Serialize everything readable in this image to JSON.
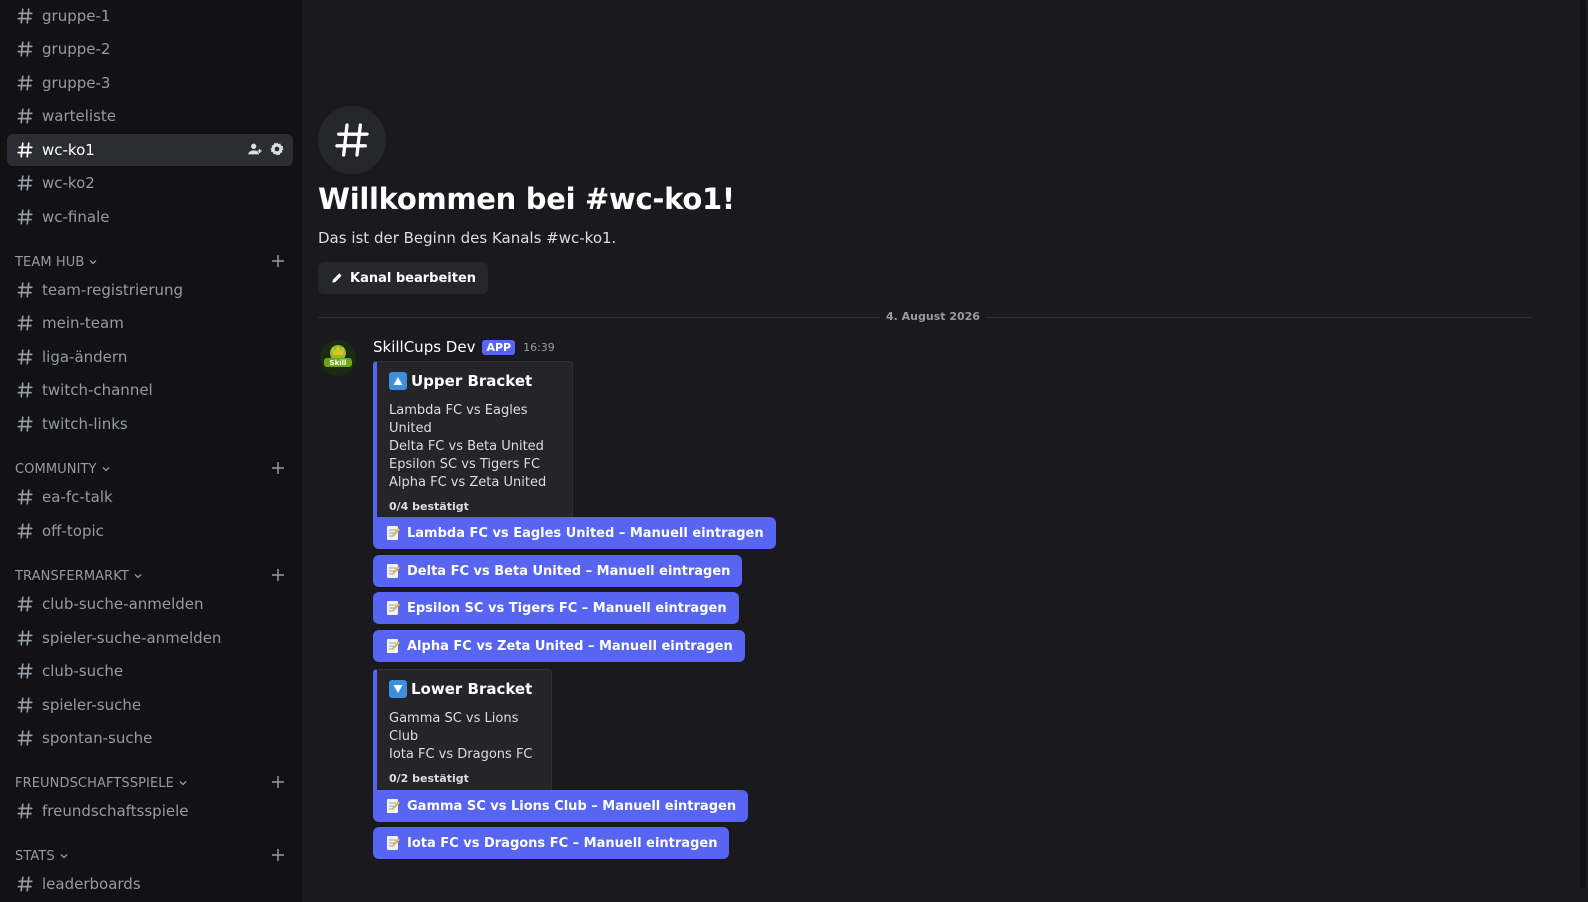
{
  "sidebar": {
    "channels_top": [
      {
        "label": "gruppe-1"
      },
      {
        "label": "gruppe-2"
      },
      {
        "label": "gruppe-3"
      },
      {
        "label": "warteliste"
      },
      {
        "label": "wc-ko1",
        "active": true
      },
      {
        "label": "wc-ko2"
      },
      {
        "label": "wc-finale"
      }
    ],
    "categories": [
      {
        "label": "TEAM HUB",
        "channels": [
          "team-registrierung",
          "mein-team",
          "liga-ändern",
          "twitch-channel",
          "twitch-links"
        ]
      },
      {
        "label": "COMMUNITY",
        "channels": [
          "ea-fc-talk",
          "off-topic"
        ]
      },
      {
        "label": "TRANSFERMARKT",
        "channels": [
          "club-suche-anmelden",
          "spieler-suche-anmelden",
          "club-suche",
          "spieler-suche",
          "spontan-suche"
        ]
      },
      {
        "label": "FREUNDSCHAFTSSPIELE",
        "channels": [
          "freundschaftsspiele"
        ]
      },
      {
        "label": "STATS",
        "channels": [
          "leaderboards"
        ]
      }
    ],
    "icons": {
      "channel": "hash-icon",
      "invite": "add-member-icon",
      "settings": "gear-icon",
      "category_toggle": "chevron-down-icon",
      "create_channel": "plus-icon"
    }
  },
  "main": {
    "welcome_title": "Willkommen bei #wc-ko1!",
    "welcome_subtitle": "Das ist der Beginn des Kanals #wc-ko1.",
    "edit_channel_label": "Kanal bearbeiten",
    "date_divider": "4. August 2026",
    "message": {
      "author": "SkillCups Dev",
      "badge": "APP",
      "time": "16:39",
      "upper_embed": {
        "title": "Upper Bracket",
        "lines": [
          "Lambda FC vs Eagles United",
          "Delta FC vs Beta United",
          "Epsilon SC vs Tigers FC",
          "Alpha FC vs Zeta United"
        ],
        "footer": "0/4 bestätigt"
      },
      "upper_buttons": [
        "Lambda FC vs Eagles United – Manuell eintragen",
        "Delta FC vs Beta United – Manuell eintragen",
        "Epsilon SC vs Tigers FC – Manuell eintragen",
        "Alpha FC vs Zeta United – Manuell eintragen"
      ],
      "lower_embed": {
        "title": "Lower Bracket",
        "lines": [
          "Gamma SC vs Lions Club",
          "Iota FC vs Dragons FC"
        ],
        "footer": "0/2 bestätigt"
      },
      "lower_buttons": [
        "Gamma SC vs Lions Club – Manuell eintragen",
        "Iota FC vs Dragons FC – Manuell eintragen"
      ]
    }
  },
  "colors": {
    "accent": "#5865f2",
    "sidebar_bg": "#121214",
    "main_bg": "#1a1a1e",
    "embed_bg": "#242429",
    "emoji_blue": "#3e8ede"
  }
}
